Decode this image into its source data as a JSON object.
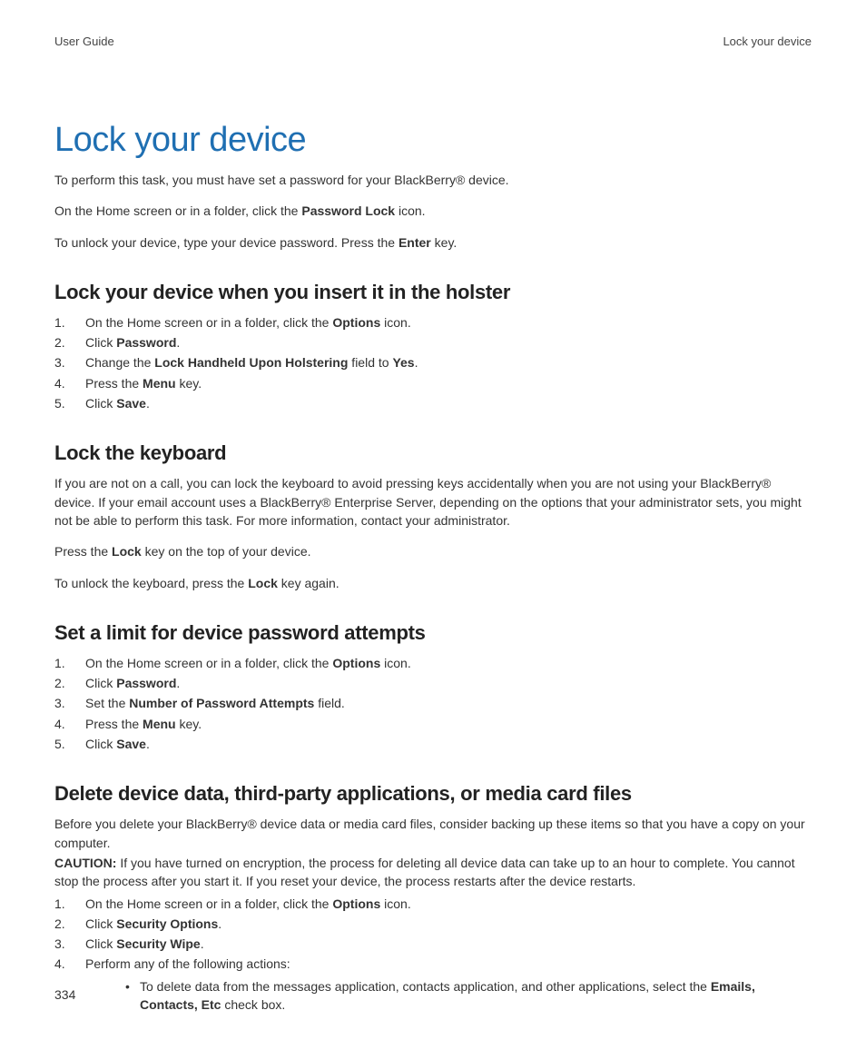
{
  "header": {
    "left": "User Guide",
    "right": "Lock your device"
  },
  "title": "Lock your device",
  "intro": {
    "p1a": "To perform this task, you must have set a password for your BlackBerry® device.",
    "p2a": "On the Home screen or in a folder, click the ",
    "p2b": "Password Lock",
    "p2c": " icon.",
    "p3a": "To unlock your device, type your device password. Press the ",
    "p3b": "Enter",
    "p3c": " key."
  },
  "sec1": {
    "heading": "Lock your device when you insert it in the holster",
    "s1a": "On the Home screen or in a folder, click the ",
    "s1b": "Options",
    "s1c": " icon.",
    "s2a": "Click ",
    "s2b": "Password",
    "s2c": ".",
    "s3a": "Change the ",
    "s3b": "Lock Handheld Upon Holstering",
    "s3c": " field to ",
    "s3d": "Yes",
    "s3e": ".",
    "s4a": "Press the ",
    "s4b": "Menu",
    "s4c": " key.",
    "s5a": "Click ",
    "s5b": "Save",
    "s5c": "."
  },
  "sec2": {
    "heading": "Lock the keyboard",
    "p1": "If you are not on a call, you can lock the keyboard to avoid pressing keys accidentally when you are not using your BlackBerry® device. If your email account uses a BlackBerry® Enterprise Server, depending on the options that your administrator sets, you might not be able to perform this task. For more information, contact your administrator.",
    "p2a": "Press the ",
    "p2b": "Lock",
    "p2c": " key on the top of your device.",
    "p3a": "To unlock the keyboard, press the ",
    "p3b": "Lock",
    "p3c": " key again."
  },
  "sec3": {
    "heading": "Set a limit for device password attempts",
    "s1a": "On the Home screen or in a folder, click the ",
    "s1b": "Options",
    "s1c": " icon.",
    "s2a": "Click ",
    "s2b": "Password",
    "s2c": ".",
    "s3a": "Set the ",
    "s3b": "Number of Password Attempts",
    "s3c": " field.",
    "s4a": "Press the ",
    "s4b": "Menu",
    "s4c": " key.",
    "s5a": "Click ",
    "s5b": "Save",
    "s5c": "."
  },
  "sec4": {
    "heading": "Delete device data, third-party applications, or media card files",
    "p1": "Before you delete your BlackBerry® device data or media card files, consider backing up these items so that you have a copy on your computer.",
    "p2a": "CAUTION:",
    "p2b": "  If you have turned on encryption, the process for deleting all device data can take up to an hour to complete. You cannot stop the process after you start it. If you reset your device, the process restarts after the device restarts.",
    "s1a": "On the Home screen or in a folder, click the ",
    "s1b": "Options",
    "s1c": " icon.",
    "s2a": "Click ",
    "s2b": "Security Options",
    "s2c": ".",
    "s3a": "Click ",
    "s3b": "Security Wipe",
    "s3c": ".",
    "s4a": "Perform any of the following actions:",
    "b1a": "To delete data from the messages application, contacts application, and other applications, select the ",
    "b1b": "Emails, Contacts, Etc",
    "b1c": " check box."
  },
  "pageNumber": "334"
}
